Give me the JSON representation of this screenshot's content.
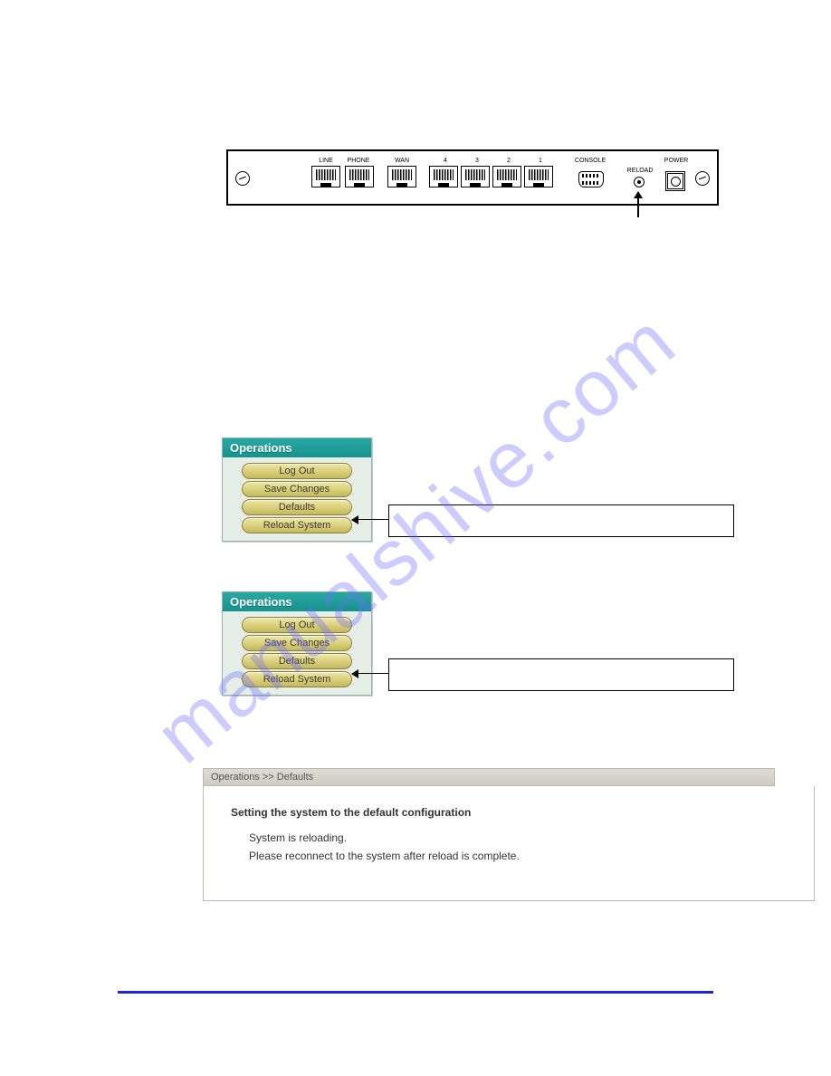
{
  "watermark": "manualshive.com",
  "device": {
    "labels": {
      "line": "LINE",
      "phone": "PHONE",
      "wan": "WAN",
      "p4": "4",
      "p3": "3",
      "p2": "2",
      "p1": "1",
      "console": "CONSOLE",
      "reload": "RELOAD",
      "power": "POWER"
    }
  },
  "operations": {
    "header": "Operations",
    "buttons": {
      "logout": "Log Out",
      "save": "Save Changes",
      "defaults": "Defaults",
      "reload": "Reload System"
    }
  },
  "status": {
    "breadcrumb": "Operations >> Defaults",
    "heading": "Setting the system to the default configuration",
    "line1": "System is reloading.",
    "line2": "Please reconnect to the system after reload is complete."
  }
}
